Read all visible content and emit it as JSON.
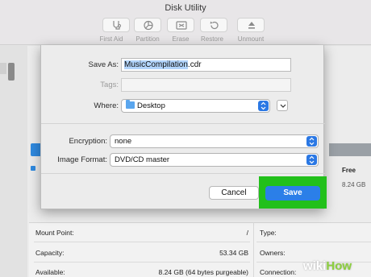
{
  "window": {
    "title": "Disk Utility"
  },
  "toolbar": {
    "buttons": [
      {
        "label": "First Aid",
        "icon": "stethoscope-icon"
      },
      {
        "label": "Partition",
        "icon": "pie-chart-icon"
      },
      {
        "label": "Erase",
        "icon": "erase-icon"
      },
      {
        "label": "Restore",
        "icon": "restore-icon"
      },
      {
        "label": "Unmount",
        "icon": "eject-icon"
      }
    ]
  },
  "dialog": {
    "save_as_label": "Save As:",
    "save_as_name": "MusicCompilation",
    "save_as_ext": ".cdr",
    "tags_label": "Tags:",
    "tags_value": "",
    "where_label": "Where:",
    "where_value": "Desktop",
    "encryption_label": "Encryption:",
    "encryption_value": "none",
    "image_format_label": "Image Format:",
    "image_format_value": "DVD/CD master",
    "cancel_label": "Cancel",
    "save_label": "Save"
  },
  "background": {
    "free_label": "Free",
    "free_value": "8.24 GB",
    "info": {
      "mount_point_label": "Mount Point:",
      "mount_point_value": "/",
      "capacity_label": "Capacity:",
      "capacity_value": "53.34 GB",
      "available_label": "Available:",
      "available_value": "8.24 GB (64 bytes purgeable)",
      "type_label": "Type:",
      "owners_label": "Owners:",
      "connection_label": "Connection:"
    }
  },
  "watermark": {
    "prefix": "wiki",
    "suffix": "How"
  },
  "colors": {
    "accent": "#2b7fe8",
    "highlight": "#22c01b"
  }
}
